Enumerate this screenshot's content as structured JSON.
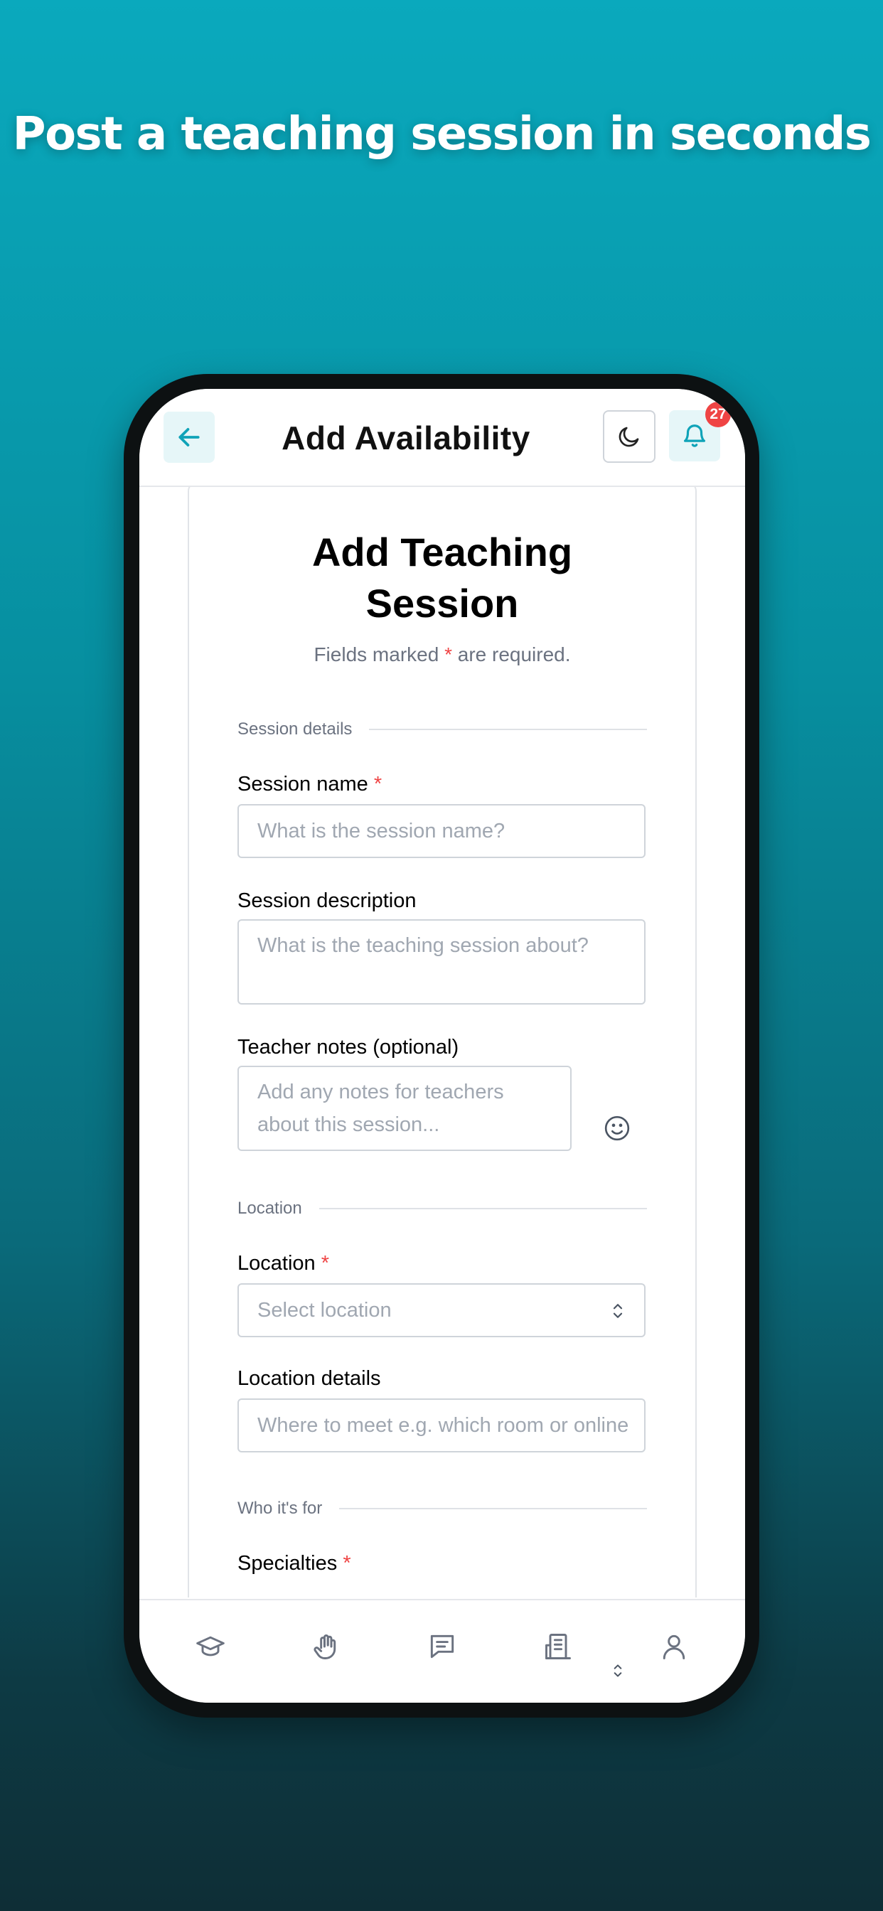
{
  "headline": "Post a teaching session in seconds",
  "appbar": {
    "title": "Add Availability",
    "back_icon": "arrow-left-icon",
    "theme_icon": "moon-icon",
    "bell_icon": "bell-icon",
    "notification_count": "27"
  },
  "form": {
    "title": "Add Teaching Session",
    "required_note_prefix": "Fields marked ",
    "required_star": "*",
    "required_note_suffix": " are required.",
    "sections": {
      "session_details": "Session details",
      "location": "Location",
      "who_its_for": "Who it's for"
    },
    "session_name": {
      "label": "Session name",
      "required": "*",
      "placeholder": "What is the session name?"
    },
    "session_description": {
      "label": "Session description",
      "placeholder": "What is the teaching session about?"
    },
    "teacher_notes": {
      "label": "Teacher notes (optional)",
      "placeholder": "Add any notes for teachers about this session..."
    },
    "location": {
      "label": "Location",
      "required": "*",
      "placeholder": "Select location"
    },
    "location_details": {
      "label": "Location details",
      "placeholder": "Where to meet e.g. which room or online"
    },
    "specialties": {
      "label": "Specialties",
      "required": "*"
    }
  },
  "bottom_nav": [
    {
      "icon": "graduation-cap-icon"
    },
    {
      "icon": "hand-icon"
    },
    {
      "icon": "message-icon"
    },
    {
      "icon": "building-icon"
    },
    {
      "icon": "user-icon"
    }
  ],
  "colors": {
    "accent": "#0fa3b8",
    "required": "#ef4444",
    "badge": "#ef4444",
    "muted_text": "#6b7280",
    "placeholder": "#a0a7b1"
  }
}
